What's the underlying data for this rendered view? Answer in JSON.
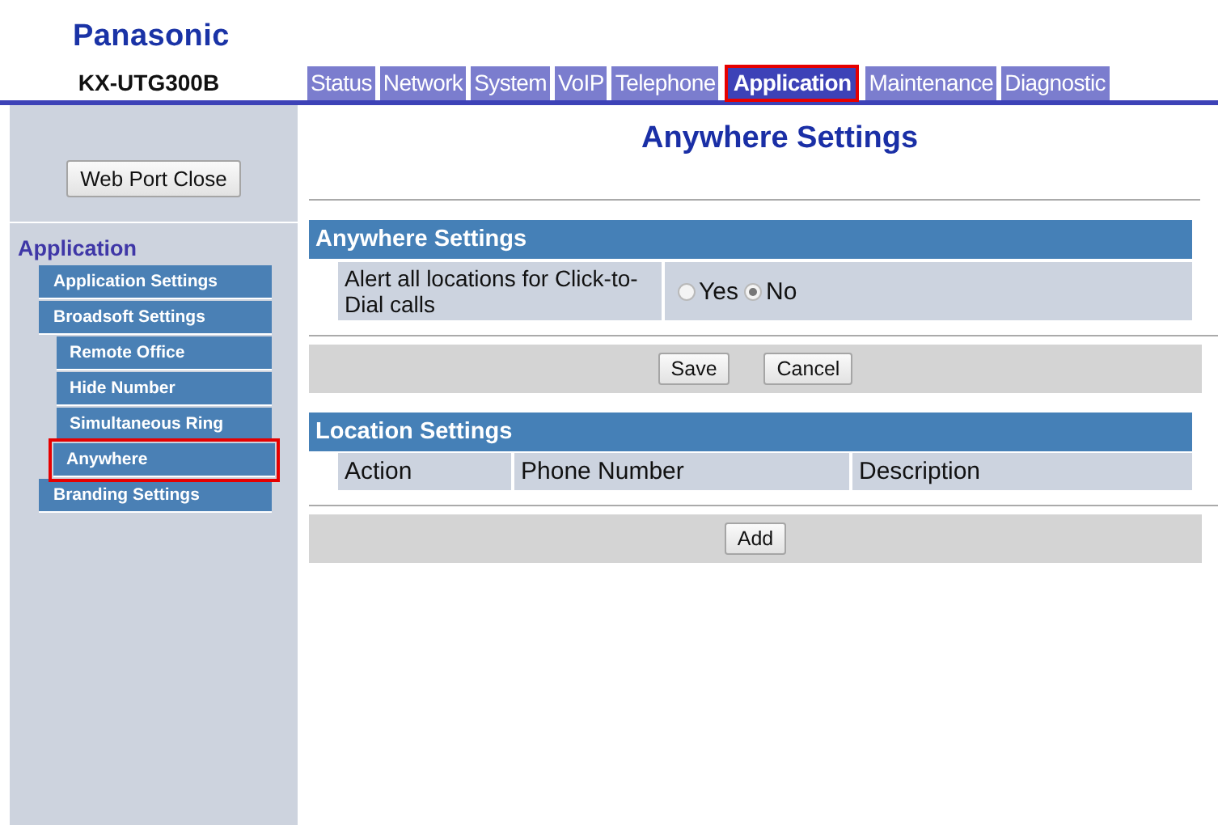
{
  "logo": "Panasonic",
  "model": "KX-UTG300B",
  "tabs": [
    {
      "label": "Status",
      "selected": false
    },
    {
      "label": "Network",
      "selected": false
    },
    {
      "label": "System",
      "selected": false
    },
    {
      "label": "VoIP",
      "selected": false
    },
    {
      "label": "Telephone",
      "selected": false
    },
    {
      "label": "Application",
      "selected": true
    },
    {
      "label": "Maintenance",
      "selected": false
    },
    {
      "label": "Diagnostic",
      "selected": false
    }
  ],
  "sidebar": {
    "button": "Web Port Close",
    "heading": "Application",
    "items": [
      {
        "label": "Application Settings",
        "selected": false
      },
      {
        "label": "Broadsoft Settings",
        "selected": false,
        "children": [
          {
            "label": "Remote Office",
            "selected": false
          },
          {
            "label": "Hide Number",
            "selected": false
          },
          {
            "label": "Simultaneous Ring",
            "selected": false
          },
          {
            "label": "Anywhere",
            "selected": true
          }
        ]
      },
      {
        "label": "Branding Settings",
        "selected": false
      }
    ]
  },
  "page_title": "Anywhere Settings",
  "anywhere_section": {
    "title": "Anywhere Settings",
    "label": "Alert all locations for Click-to-Dial calls",
    "options": [
      {
        "label": "Yes",
        "selected": false
      },
      {
        "label": "No",
        "selected": true
      }
    ]
  },
  "form_buttons": [
    "Save",
    "Cancel"
  ],
  "location_section": {
    "title": "Location Settings",
    "columns": [
      "Action",
      "Phone Number",
      "Description"
    ]
  },
  "add_button": "Add"
}
